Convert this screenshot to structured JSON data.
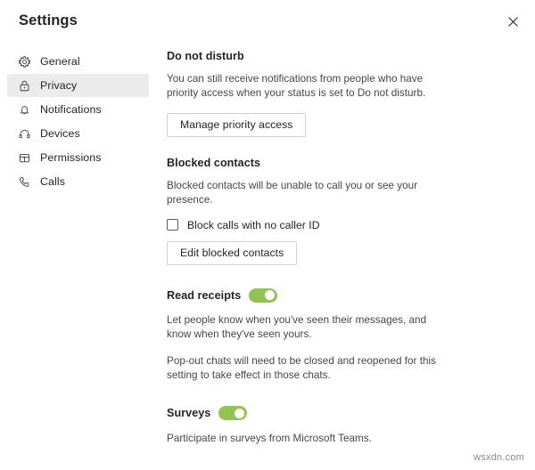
{
  "window": {
    "title": "Settings",
    "close_icon": "close-icon"
  },
  "sidebar": {
    "items": [
      {
        "label": "General",
        "icon": "gear-icon",
        "selected": false
      },
      {
        "label": "Privacy",
        "icon": "lock-icon",
        "selected": true
      },
      {
        "label": "Notifications",
        "icon": "bell-icon",
        "selected": false
      },
      {
        "label": "Devices",
        "icon": "headset-icon",
        "selected": false
      },
      {
        "label": "Permissions",
        "icon": "permissions-icon",
        "selected": false
      },
      {
        "label": "Calls",
        "icon": "phone-icon",
        "selected": false
      }
    ]
  },
  "content": {
    "do_not_disturb": {
      "heading": "Do not disturb",
      "description": "You can still receive notifications from people who have priority access when your status is set to Do not disturb.",
      "button_label": "Manage priority access"
    },
    "blocked_contacts": {
      "heading": "Blocked contacts",
      "description": "Blocked contacts will be unable to call you or see your presence.",
      "checkbox_label": "Block calls with no caller ID",
      "checkbox_checked": false,
      "button_label": "Edit blocked contacts"
    },
    "read_receipts": {
      "heading": "Read receipts",
      "toggle_on": true,
      "description_1": "Let people know when you've seen their messages, and know when they've seen yours.",
      "description_2": "Pop-out chats will need to be closed and reopened for this setting to take effect in those chats."
    },
    "surveys": {
      "heading": "Surveys",
      "toggle_on": true,
      "description": "Participate in surveys from Microsoft Teams."
    }
  },
  "watermark": {
    "text": "wsxdn.com"
  },
  "colors": {
    "toggle_on": "#92c353",
    "selected_item_bg": "#ebebeb",
    "border": "#d2d0ce",
    "text_primary": "#252423",
    "text_secondary": "#484644"
  }
}
